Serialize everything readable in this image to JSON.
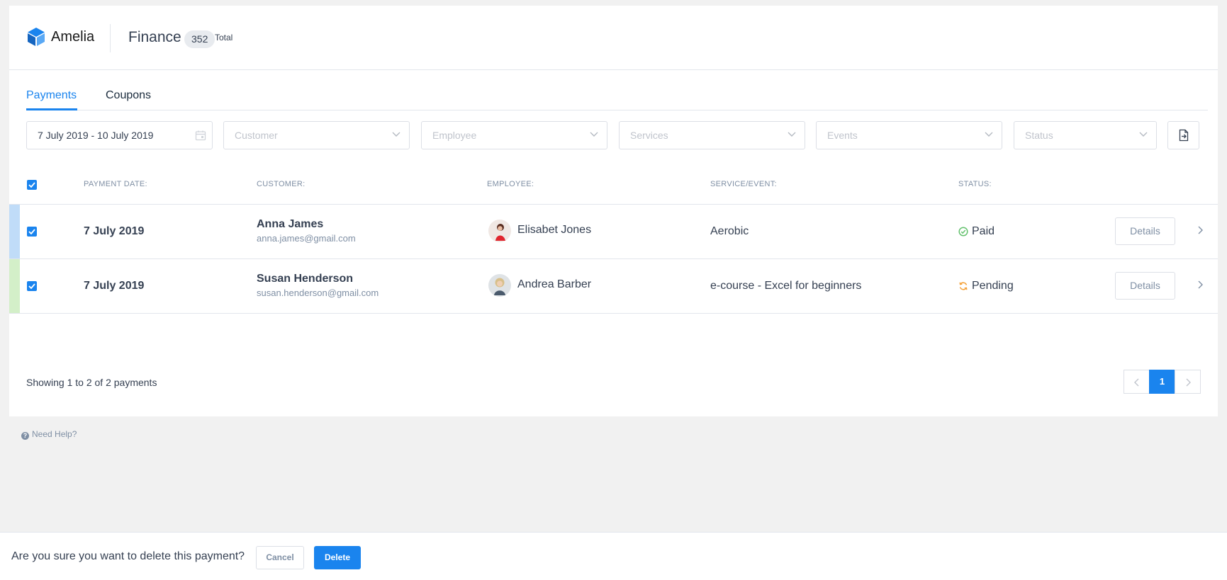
{
  "header": {
    "logo_text": "Amelia",
    "title": "Finance",
    "count": "352",
    "count_label": "Total"
  },
  "tabs": [
    {
      "label": "Payments",
      "active": true
    },
    {
      "label": "Coupons",
      "active": false
    }
  ],
  "filters": {
    "date_range": "7 July 2019 - 10 July 2019",
    "customer_placeholder": "Customer",
    "employee_placeholder": "Employee",
    "services_placeholder": "Services",
    "events_placeholder": "Events",
    "status_placeholder": "Status"
  },
  "table": {
    "columns": [
      "PAYMENT DATE:",
      "CUSTOMER:",
      "EMPLOYEE:",
      "SERVICE/EVENT:",
      "STATUS:"
    ],
    "rows": [
      {
        "date": "7 July 2019",
        "customer_name": "Anna James",
        "customer_email": "anna.james@gmail.com",
        "employee": "Elisabet Jones",
        "service": "Aerobic",
        "status": "Paid",
        "details_label": "Details"
      },
      {
        "date": "7 July 2019",
        "customer_name": "Susan Henderson",
        "customer_email": "susan.henderson@gmail.com",
        "employee": "Andrea Barber",
        "service": "e-course - Excel for beginners",
        "status": "Pending",
        "details_label": "Details"
      }
    ]
  },
  "pagination": {
    "summary": "Showing 1 to 2 of 2 payments",
    "current_page": "1"
  },
  "help": {
    "label": "Need Help?",
    "icon_glyph": "?"
  },
  "confirm": {
    "message": "Are you sure you want to delete this payment?",
    "cancel_label": "Cancel",
    "delete_label": "Delete"
  },
  "colors": {
    "accent": "#1a84ee",
    "paid": "#63c16d",
    "pending": "#f4a23a",
    "row1_marker": "#c0dcf8",
    "row2_marker": "#d3efc8"
  }
}
